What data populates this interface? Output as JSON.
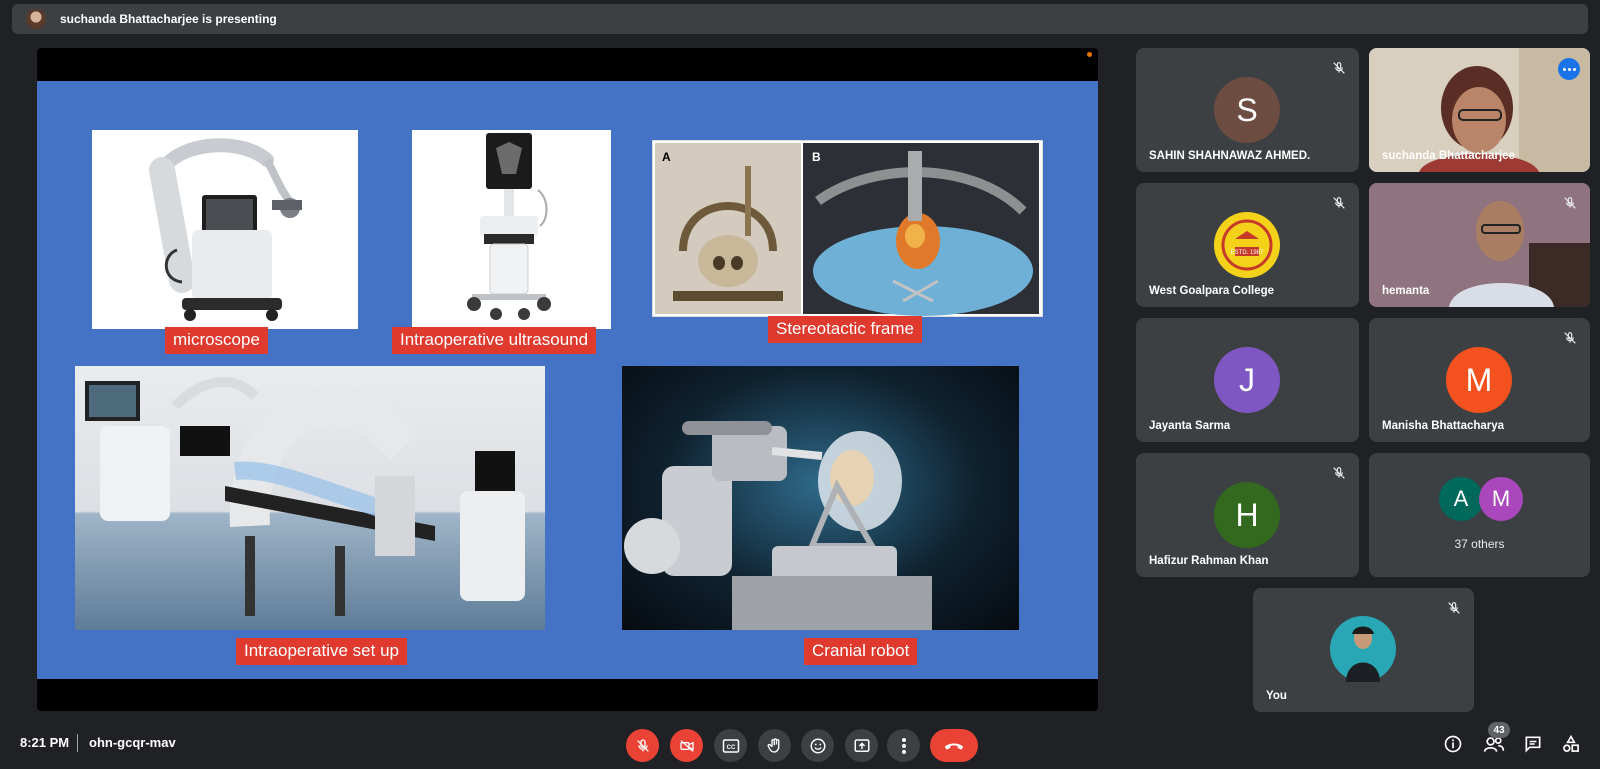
{
  "topbar": {
    "presenting_text": "suchanda Bhattacharjee is presenting"
  },
  "slide": {
    "captions": {
      "microscope": "microscope",
      "ultrasound": "Intraoperative ultrasound",
      "stereotactic": "Stereotactic frame",
      "setup": "Intraoperative set up",
      "robot": "Cranial robot"
    },
    "stereo_labels": {
      "a": "A",
      "b": "B"
    },
    "logo_text": "WEST GOALPARA COLLEGE"
  },
  "participants": [
    {
      "name": "SAHIN SHAHNAWAZ AHMED.",
      "initial": "S",
      "color": "#6d4c41",
      "muted": true
    },
    {
      "name": "suchanda Bhattacharjee",
      "video": true,
      "speaking": true
    },
    {
      "name": "West Goalpara College",
      "logo": true,
      "muted": true,
      "logo_year": "ESTD. 1987"
    },
    {
      "name": "hemanta",
      "video": true,
      "muted": true
    },
    {
      "name": "Jayanta Sarma",
      "initial": "J",
      "color": "#7e57c2",
      "muted": false
    },
    {
      "name": "Manisha Bhattacharya",
      "initial": "M",
      "color": "#f4511e",
      "muted": true
    },
    {
      "name": "Hafizur Rahman Khan",
      "initial": "H",
      "color": "#33691e",
      "muted": true
    },
    {
      "others_label": "37 others",
      "initials": [
        "A",
        "M"
      ],
      "colors": [
        "#00695c",
        "#ab47bc"
      ]
    },
    {
      "name": "You",
      "video": true,
      "muted": true
    }
  ],
  "bottom": {
    "time": "8:21 PM",
    "meeting_code": "ohn-gcqr-mav",
    "participants_count": "43",
    "colors": {
      "red": "#ea4335",
      "button": "#3c4043"
    }
  }
}
